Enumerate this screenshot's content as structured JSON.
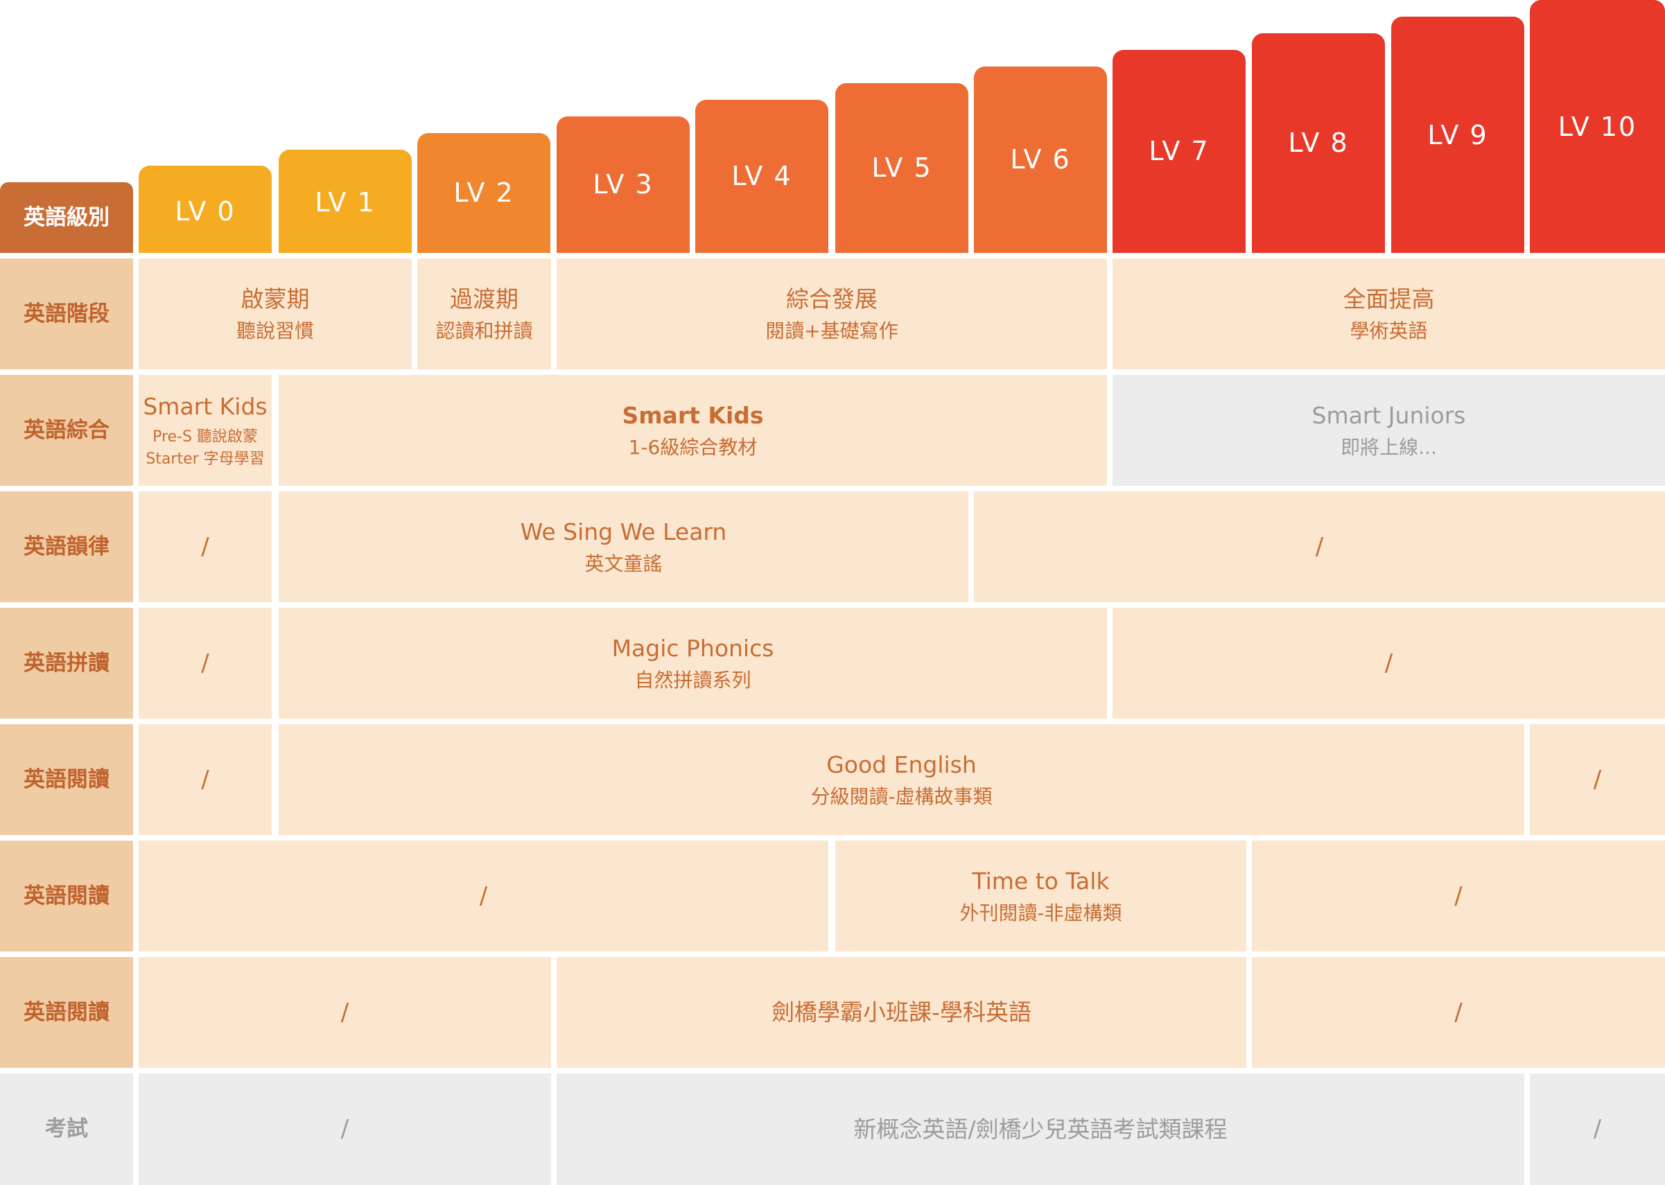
{
  "colors": {
    "lv0": "#f6ac22",
    "lv1": "#f6ac22",
    "lv2": "#f0862e",
    "lv3": "#ee6d35",
    "lv4": "#ee6d35",
    "lv5": "#ee6d35",
    "lv6": "#ee6d35",
    "lv7": "#e8382a",
    "lv8": "#e8382a",
    "lv9": "#e8382a",
    "lv10": "#e8382a",
    "level_header": "#c86d35",
    "row_label_bg": "#f0cca4",
    "cell_bg": "#fbe7cf",
    "cell_text": "#c86d35",
    "disabled_bg": "#ececec",
    "disabled_text": "#9c9c9c"
  },
  "levels": [
    "LV 0",
    "LV 1",
    "LV 2",
    "LV 3",
    "LV 4",
    "LV 5",
    "LV 6",
    "LV 7",
    "LV 8",
    "LV 9",
    "LV 10"
  ],
  "level_header_label": "英語級別",
  "rows": {
    "stage": {
      "label": "英語階段",
      "c1": {
        "title": "啟蒙期",
        "sub": "聽說習慣"
      },
      "c2": {
        "title": "過渡期",
        "sub": "認讀和拼讀"
      },
      "c3": {
        "title": "綜合發展",
        "sub": "閱讀+基礎寫作"
      },
      "c4": {
        "title": "全面提高",
        "sub": "學術英語"
      }
    },
    "comprehensive": {
      "label": "英語綜合",
      "c1": {
        "title": "Smart Kids",
        "line1": "Pre-S 聽說啟蒙",
        "line2": "Starter 字母學習"
      },
      "c2": {
        "title": "Smart Kids",
        "sub": "1-6級綜合教材"
      },
      "c3": {
        "title": "Smart Juniors",
        "sub": "即將上線..."
      }
    },
    "rhythm": {
      "label": "英語韻律",
      "c1": "/",
      "c2": {
        "title": "We Sing We Learn",
        "sub": "英文童謠"
      },
      "c3": "/"
    },
    "phonics": {
      "label": "英語拼讀",
      "c1": "/",
      "c2": {
        "title": "Magic Phonics",
        "sub": "自然拼讀系列"
      },
      "c3": "/"
    },
    "reading1": {
      "label": "英語閱讀",
      "c1": "/",
      "c2": {
        "title": "Good English",
        "sub": "分級閱讀-虛構故事類"
      },
      "c3": "/"
    },
    "reading2": {
      "label": "英語閱讀",
      "c1": "/",
      "c2": {
        "title": "Time to Talk",
        "sub": "外刊閱讀-非虛構類"
      },
      "c3": "/"
    },
    "reading3": {
      "label": "英語閱讀",
      "c1": "/",
      "c2": "劍橋學霸小班課-學科英語",
      "c3": "/"
    },
    "exam": {
      "label": "考試",
      "c1": "/",
      "c2": "新概念英語/劍橋少兒英語考試類課程",
      "c3": "/"
    }
  }
}
